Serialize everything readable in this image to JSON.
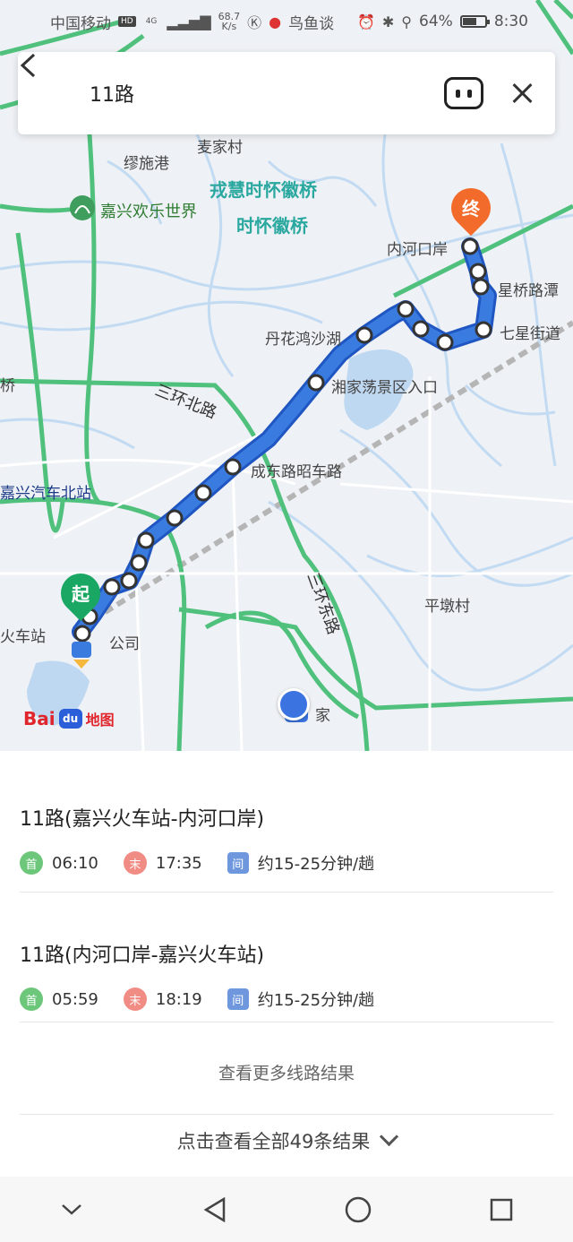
{
  "status_bar": {
    "carrier": "中国移动",
    "hd_badge": "HD",
    "network": "4G",
    "speed_value": "68.7",
    "speed_unit": "K/s",
    "app_hint": "鸟鱼谈",
    "battery": "64%",
    "battery_level": 0.64,
    "time": "8:30"
  },
  "search": {
    "query": "11路"
  },
  "map": {
    "labels": {
      "maijia": "麦家村",
      "xiancuo": "缪施港",
      "park": "嘉兴欢乐世界",
      "bridge1": "戎慧时怀徽桥",
      "bridge2": "时怀徽桥",
      "neihe": "内河口岸",
      "xingqiao": "星桥路潭",
      "xingbei": "七星街道",
      "danhua": "丹花鸿沙湖",
      "liujia": "湘家荡景区入口",
      "ring_north": "三环北路",
      "chengdong": "成东路昭车路",
      "north_station": "嘉兴汽车北站",
      "east_ring": "三环东路",
      "pingdun": "平墩村",
      "start_station": "火车站",
      "gongsi": "公司",
      "jia": "家",
      "bridge_left": "桥"
    },
    "start_marker": "起",
    "end_marker": "终",
    "logo_text": "Bai",
    "logo_paw": "du",
    "logo_suffix": "地图"
  },
  "routes": [
    {
      "title": "11路(嘉兴火车站-内河口岸)",
      "first_label": "首",
      "first_time": "06:10",
      "last_label": "末",
      "last_time": "17:35",
      "interval_label": "间",
      "interval": "约15-25分钟/趟"
    },
    {
      "title": "11路(内河口岸-嘉兴火车站)",
      "first_label": "首",
      "first_time": "05:59",
      "last_label": "末",
      "last_time": "18:19",
      "interval_label": "间",
      "interval": "约15-25分钟/趟"
    }
  ],
  "more_lines": "查看更多线路结果",
  "view_all": "点击查看全部49条结果",
  "colors": {
    "route_blue": "#3a7be0",
    "road_green": "#4fc17c",
    "water_blue": "#bfd8f2",
    "start_green": "#1aa763",
    "end_orange": "#f26b2b"
  }
}
